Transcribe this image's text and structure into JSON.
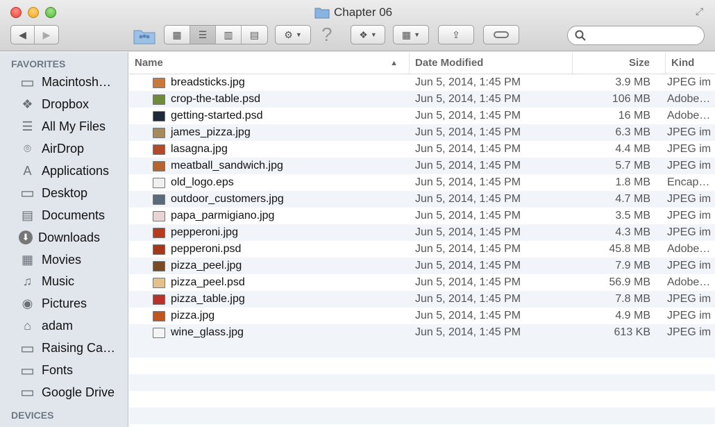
{
  "window": {
    "title": "Chapter 06"
  },
  "toolbar": {
    "search_placeholder": ""
  },
  "sidebar": {
    "favorites_heading": "FAVORITES",
    "devices_heading": "DEVICES",
    "items": [
      {
        "label": "Macintosh…",
        "icon": "harddrive-icon"
      },
      {
        "label": "Dropbox",
        "icon": "dropbox-icon"
      },
      {
        "label": "All My Files",
        "icon": "all-files-icon"
      },
      {
        "label": "AirDrop",
        "icon": "airdrop-icon"
      },
      {
        "label": "Applications",
        "icon": "applications-icon"
      },
      {
        "label": "Desktop",
        "icon": "desktop-icon"
      },
      {
        "label": "Documents",
        "icon": "documents-icon"
      },
      {
        "label": "Downloads",
        "icon": "downloads-icon"
      },
      {
        "label": "Movies",
        "icon": "movies-icon"
      },
      {
        "label": "Music",
        "icon": "music-icon"
      },
      {
        "label": "Pictures",
        "icon": "pictures-icon"
      },
      {
        "label": "adam",
        "icon": "home-icon"
      },
      {
        "label": "Raising Ca…",
        "icon": "folder-icon"
      },
      {
        "label": "Fonts",
        "icon": "folder-icon"
      },
      {
        "label": "Google Drive",
        "icon": "folder-icon"
      }
    ]
  },
  "columns": {
    "name": "Name",
    "date": "Date Modified",
    "size": "Size",
    "kind": "Kind"
  },
  "files": [
    {
      "name": "breadsticks.jpg",
      "date": "Jun 5, 2014, 1:45 PM",
      "size": "3.9 MB",
      "kind": "JPEG im",
      "thumb": "#c97a3a"
    },
    {
      "name": "crop-the-table.psd",
      "date": "Jun 5, 2014, 1:45 PM",
      "size": "106 MB",
      "kind": "Adobe…",
      "thumb": "#6f8a3a"
    },
    {
      "name": "getting-started.psd",
      "date": "Jun 5, 2014, 1:45 PM",
      "size": "16 MB",
      "kind": "Adobe…",
      "thumb": "#1d2a3a"
    },
    {
      "name": "james_pizza.jpg",
      "date": "Jun 5, 2014, 1:45 PM",
      "size": "6.3 MB",
      "kind": "JPEG im",
      "thumb": "#a88a5a"
    },
    {
      "name": "lasagna.jpg",
      "date": "Jun 5, 2014, 1:45 PM",
      "size": "4.4 MB",
      "kind": "JPEG im",
      "thumb": "#b54a2a"
    },
    {
      "name": "meatball_sandwich.jpg",
      "date": "Jun 5, 2014, 1:45 PM",
      "size": "5.7 MB",
      "kind": "JPEG im",
      "thumb": "#b8642e"
    },
    {
      "name": "old_logo.eps",
      "date": "Jun 5, 2014, 1:45 PM",
      "size": "1.8 MB",
      "kind": "Encap…",
      "thumb": "#efefef"
    },
    {
      "name": "outdoor_customers.jpg",
      "date": "Jun 5, 2014, 1:45 PM",
      "size": "4.7 MB",
      "kind": "JPEG im",
      "thumb": "#5a6a7a"
    },
    {
      "name": "papa_parmigiano.jpg",
      "date": "Jun 5, 2014, 1:45 PM",
      "size": "3.5 MB",
      "kind": "JPEG im",
      "thumb": "#e8d4d4"
    },
    {
      "name": "pepperoni.jpg",
      "date": "Jun 5, 2014, 1:45 PM",
      "size": "4.3 MB",
      "kind": "JPEG im",
      "thumb": "#b83a1e"
    },
    {
      "name": "pepperoni.psd",
      "date": "Jun 5, 2014, 1:45 PM",
      "size": "45.8 MB",
      "kind": "Adobe…",
      "thumb": "#a8361c"
    },
    {
      "name": "pizza_peel.jpg",
      "date": "Jun 5, 2014, 1:45 PM",
      "size": "7.9 MB",
      "kind": "JPEG im",
      "thumb": "#7a4a22"
    },
    {
      "name": "pizza_peel.psd",
      "date": "Jun 5, 2014, 1:45 PM",
      "size": "56.9 MB",
      "kind": "Adobe…",
      "thumb": "#e6c08a"
    },
    {
      "name": "pizza_table.jpg",
      "date": "Jun 5, 2014, 1:45 PM",
      "size": "7.8 MB",
      "kind": "JPEG im",
      "thumb": "#b8322a"
    },
    {
      "name": "pizza.jpg",
      "date": "Jun 5, 2014, 1:45 PM",
      "size": "4.9 MB",
      "kind": "JPEG im",
      "thumb": "#c2541e"
    },
    {
      "name": "wine_glass.jpg",
      "date": "Jun 5, 2014, 1:45 PM",
      "size": "613 KB",
      "kind": "JPEG im",
      "thumb": "#f4f4f4"
    }
  ]
}
